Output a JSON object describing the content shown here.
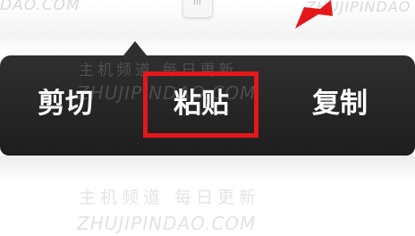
{
  "context_menu": {
    "items": [
      {
        "label": "剪切"
      },
      {
        "label": "粘贴",
        "highlighted": true
      },
      {
        "label": "复制"
      }
    ]
  },
  "watermark": {
    "url": "ZHUJIPINDAO.COM",
    "url_fragment_top_left": "DAO.COM",
    "url_fragment_top_right": "ZHUJIPINDAO",
    "chinese": "主机频道 每日更新"
  },
  "annotation": {
    "highlight_color": "#e4171b",
    "arrow_color": "#e4171b",
    "arrow_icon": "red-arrow-icon"
  }
}
